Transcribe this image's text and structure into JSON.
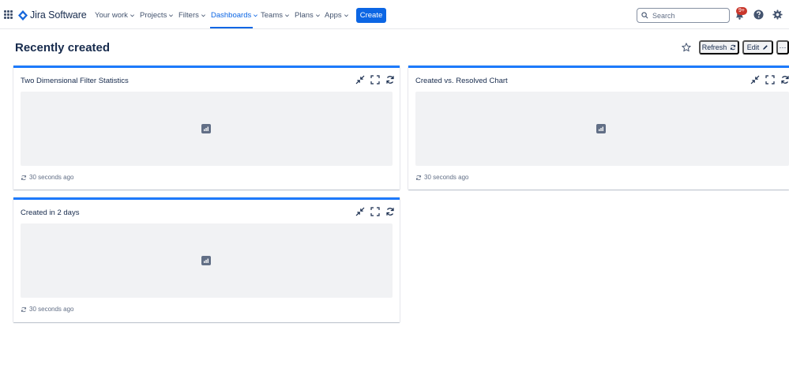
{
  "nav": {
    "product_name": "Jira Software",
    "items": [
      {
        "label": "Your work"
      },
      {
        "label": "Projects"
      },
      {
        "label": "Filters"
      },
      {
        "label": "Dashboards"
      },
      {
        "label": "Teams"
      },
      {
        "label": "Plans"
      },
      {
        "label": "Apps"
      }
    ],
    "active_item": "Dashboards",
    "create_label": "Create",
    "search_placeholder": "Search",
    "notification_badge": "9+"
  },
  "page": {
    "title": "Recently created",
    "refresh_label": "Refresh",
    "edit_label": "Edit",
    "more_label": "···"
  },
  "gadgets": [
    {
      "title": "Two Dimensional Filter Statistics",
      "updated": "30 seconds ago"
    },
    {
      "title": "Created vs. Resolved Chart",
      "updated": "30 seconds ago"
    },
    {
      "title": "Created in 2 days",
      "updated": "30 seconds ago"
    }
  ],
  "colors": {
    "brand": "#0c66e4",
    "gadget_border": "#1d7afc",
    "placeholder_bg": "#f1f2f4",
    "badge": "#c9372c"
  },
  "icons": [
    "app-switcher-icon",
    "jira-logo-icon",
    "chevron-down-icon",
    "search-icon",
    "bell-icon",
    "help-icon",
    "gear-icon",
    "star-icon",
    "refresh-icon",
    "pencil-icon",
    "minimize-icon",
    "fullscreen-icon",
    "chart-icon"
  ]
}
